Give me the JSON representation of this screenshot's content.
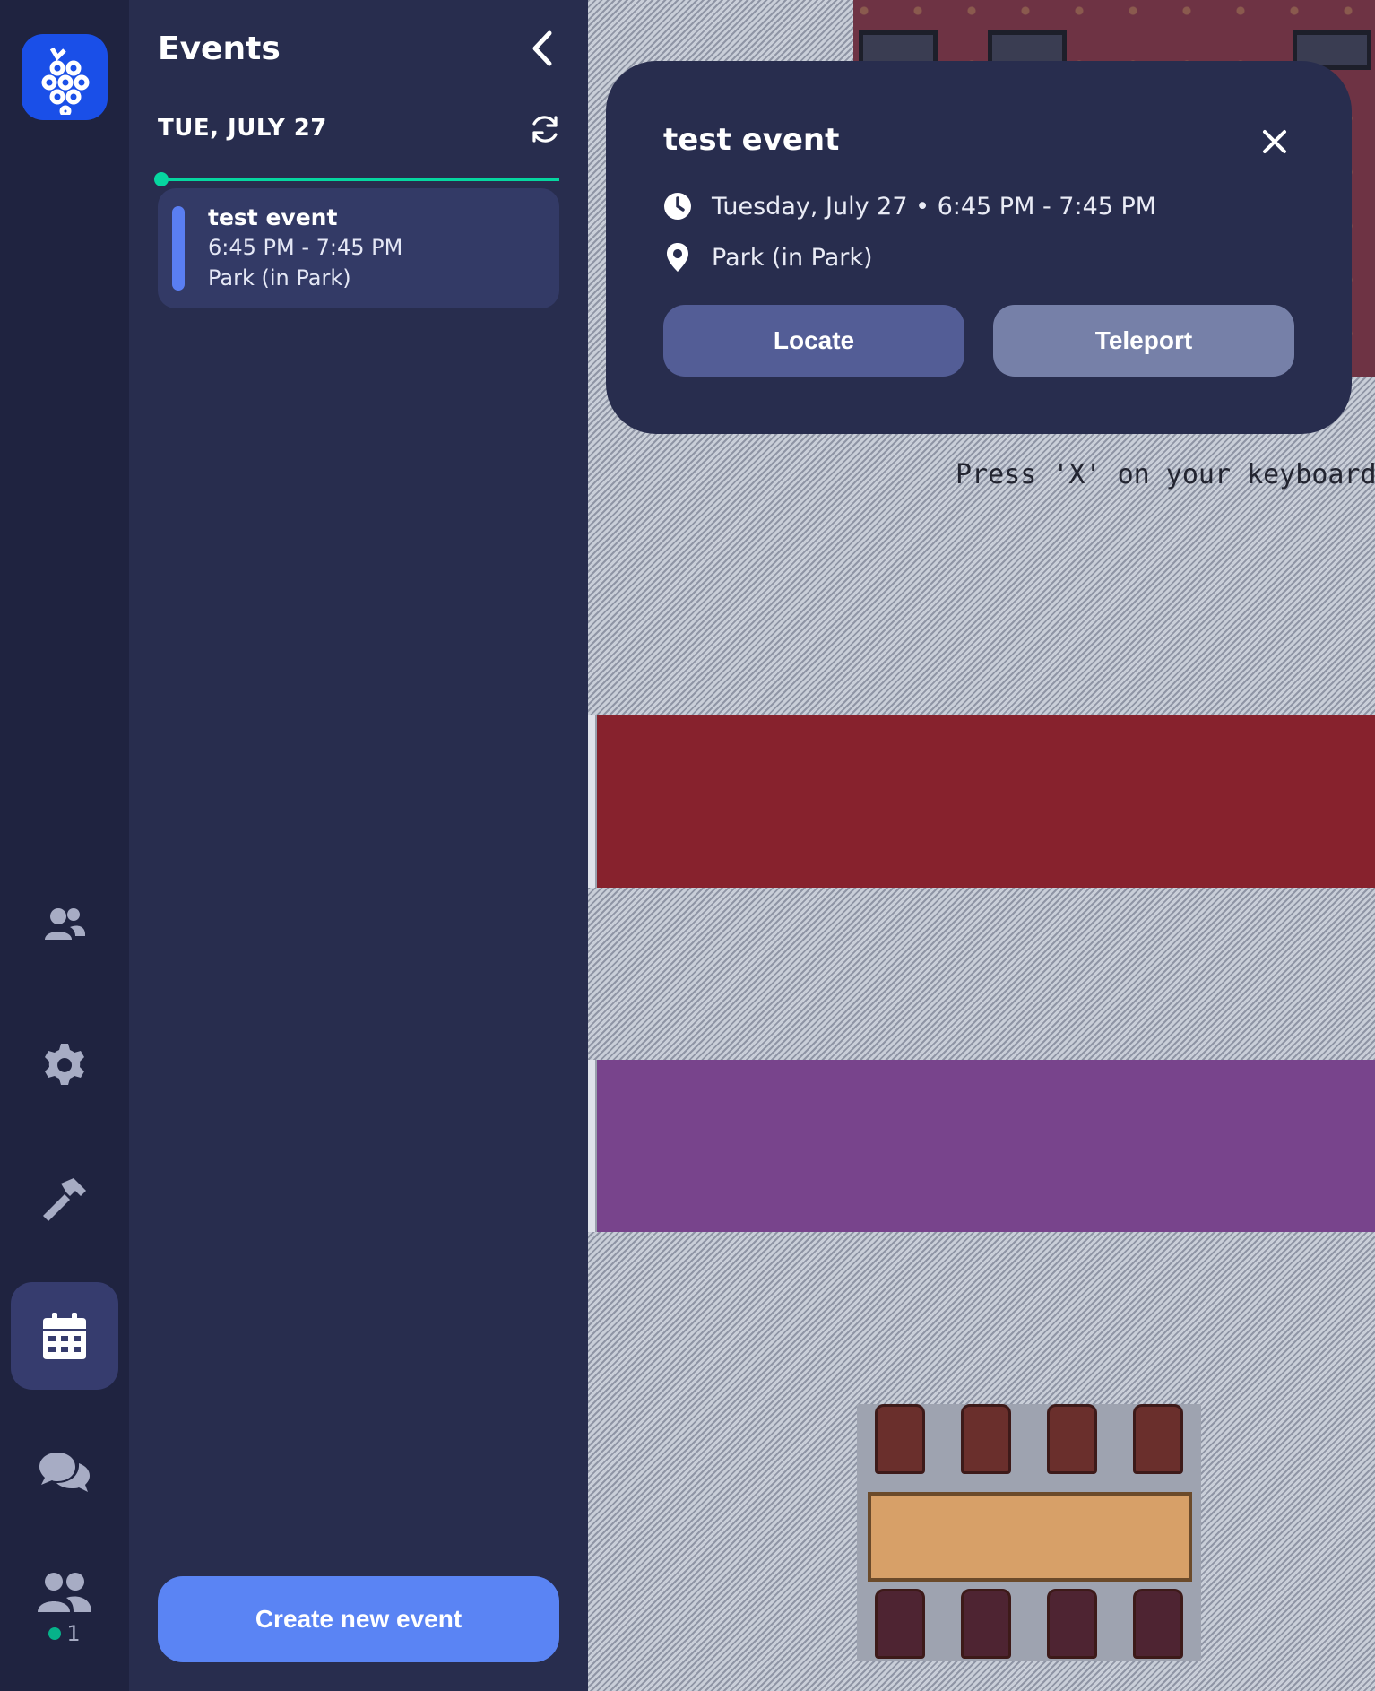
{
  "sidebar": {
    "items": [
      {
        "name": "participants",
        "icon": "users-icon"
      },
      {
        "name": "settings",
        "icon": "gear-icon"
      },
      {
        "name": "build",
        "icon": "hammer-icon"
      },
      {
        "name": "calendar",
        "icon": "calendar-icon",
        "active": true
      },
      {
        "name": "chat",
        "icon": "chat-icon"
      },
      {
        "name": "people",
        "icon": "people-icon"
      }
    ],
    "online_count": "1"
  },
  "events_panel": {
    "title": "Events",
    "date_header": "TUE, JULY 27",
    "events": [
      {
        "name": "test event",
        "time": "6:45 PM - 7:45 PM",
        "location": "Park (in Park)"
      }
    ],
    "create_label": "Create new event"
  },
  "map": {
    "sign_text": "Press 'X' on your keyboard to int"
  },
  "popup": {
    "title": "test event",
    "datetime": "Tuesday, July 27 • 6:45 PM - 7:45 PM",
    "location": "Park (in Park)",
    "locate_label": "Locate",
    "teleport_label": "Teleport"
  },
  "colors": {
    "accent": "#5a84f4",
    "timeline": "#06d6a0",
    "online_dot": "#06b28a",
    "panel_bg": "#282d4e",
    "rail_bg": "#1f2340"
  }
}
